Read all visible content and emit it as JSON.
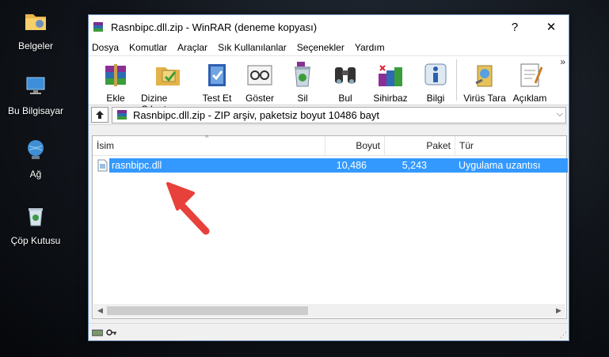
{
  "desktop": {
    "icons": [
      {
        "label": "Belgeler"
      },
      {
        "label": "Bu Bilgisayar"
      },
      {
        "label": "Ağ"
      },
      {
        "label": "Çöp Kutusu"
      }
    ]
  },
  "window": {
    "title": "Rasnbipc.dll.zip - WinRAR (deneme kopyası)",
    "help_label": "?",
    "close_label": "✕"
  },
  "menu": {
    "items": [
      {
        "label": "Dosya"
      },
      {
        "label": "Komutlar"
      },
      {
        "label": "Araçlar"
      },
      {
        "label": "Sık Kullanılanlar"
      },
      {
        "label": "Seçenekler"
      },
      {
        "label": "Yardım"
      }
    ]
  },
  "toolbar": {
    "items": [
      {
        "label": "Ekle"
      },
      {
        "label": "Dizine Çıkart"
      },
      {
        "label": "Test Et"
      },
      {
        "label": "Göster"
      },
      {
        "label": "Sil"
      },
      {
        "label": "Bul"
      },
      {
        "label": "Sihirbaz"
      },
      {
        "label": "Bilgi"
      },
      {
        "label": "Virüs Tara"
      },
      {
        "label": "Açıklam"
      }
    ],
    "more_label": "»"
  },
  "address": {
    "text": "Rasnbipc.dll.zip - ZIP arşiv, paketsiz boyut 10486 bayt"
  },
  "list": {
    "columns": [
      "İsim",
      "Boyut",
      "Paket",
      "Tür"
    ],
    "rows": [
      {
        "name": "rasnbipc.dll",
        "size": "10,486",
        "packed": "5,243",
        "type": "Uygulama uzantısı"
      }
    ]
  },
  "colors": {
    "selection": "#3399ff",
    "arrow": "#e8403a"
  }
}
